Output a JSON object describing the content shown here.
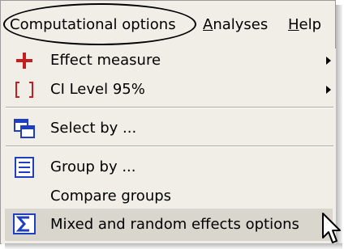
{
  "menubar": {
    "computational_options": "Computational options",
    "analyses": "Analyses",
    "analyses_rest": "nalyses",
    "analyses_mnemonic": "A",
    "help": "Help",
    "help_mnemonic": "H",
    "help_rest": "elp"
  },
  "menu": {
    "items": [
      {
        "label": "Effect measure",
        "icon": "plus-icon",
        "submenu": true
      },
      {
        "label": "CI Level  95%",
        "icon": "brackets-icon",
        "submenu": true
      },
      {
        "label": "Select by ...",
        "icon": "select-windows-icon",
        "submenu": false
      },
      {
        "label": "Group by ...",
        "icon": "group-list-icon",
        "submenu": false
      },
      {
        "label": "Compare groups",
        "icon": "",
        "submenu": false
      },
      {
        "label": "Mixed and random effects options",
        "icon": "sigma-icon",
        "submenu": false
      }
    ]
  },
  "colors": {
    "menu_bg": "#f0eee6",
    "icon_red": "#c41e1e",
    "icon_blue": "#1f3fbf",
    "highlight": "#d8d6cd"
  }
}
